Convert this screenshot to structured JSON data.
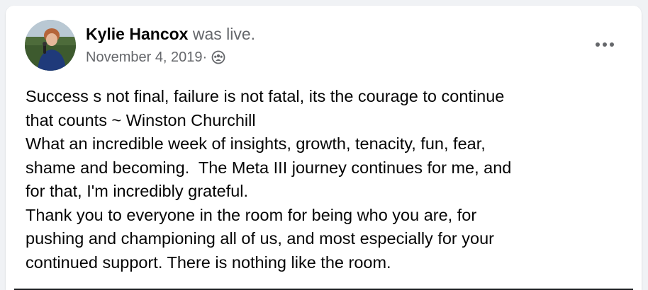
{
  "post": {
    "author": "Kylie Hancox",
    "action": " was live.",
    "date": "November 4, 2019",
    "separator": " · ",
    "audience_icon": "group-icon",
    "more_icon": "more-options-icon",
    "text_lines": [
      "Success s not final, failure is not fatal, its the courage to continue",
      "that counts ~ Winston Churchill",
      "What an incredible week of insights, growth, tenacity, fun, fear,",
      "shame and becoming.  The Meta III journey continues for me, and",
      "for that, I'm incredibly grateful.",
      "Thank you to everyone in the room for being who you are, for",
      "pushing and championing all of us, and most especially for your",
      "continued support. There is nothing like the room."
    ]
  },
  "colors": {
    "background": "#f0f2f5",
    "card": "#ffffff",
    "primary_text": "#050505",
    "secondary_text": "#65676b"
  }
}
